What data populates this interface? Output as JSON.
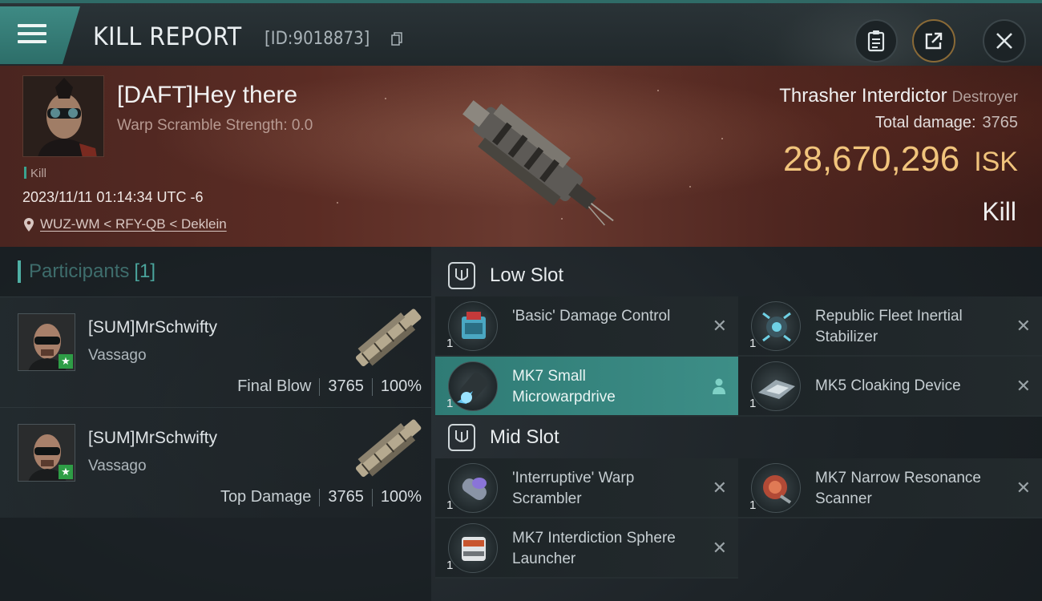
{
  "header": {
    "title": "KILL REPORT",
    "report_id": "[ID:9018873]"
  },
  "victim": {
    "name": "[DAFT]Hey there",
    "warp_scramble": "Warp Scramble Strength: 0.0",
    "tag": "Kill",
    "time": "2023/11/11 01:14:34 UTC -6",
    "location": "WUZ-WM < RFY-QB < Deklein",
    "ship": "Thrasher Interdictor",
    "ship_class": "Destroyer",
    "total_damage_label": "Total damage:",
    "total_damage": "3765",
    "isk_value": "28,670,296",
    "isk_unit": "ISK",
    "result": "Kill"
  },
  "participants": {
    "label": "Participants",
    "count": "[1]",
    "rows": [
      {
        "name": "[SUM]MrSchwifty",
        "ship": "Vassago",
        "role": "Final Blow",
        "damage": "3765",
        "percent": "100%"
      },
      {
        "name": "[SUM]MrSchwifty",
        "ship": "Vassago",
        "role": "Top Damage",
        "damage": "3765",
        "percent": "100%"
      }
    ]
  },
  "low_slot": {
    "label": "Low Slot",
    "items": [
      {
        "name": "'Basic' Damage Control",
        "qty": "1"
      },
      {
        "name": "Republic Fleet Inertial Stabilizer",
        "qty": "1"
      },
      {
        "name": "MK7 Small Microwarpdrive",
        "qty": "1"
      },
      {
        "name": "MK5 Cloaking Device",
        "qty": "1"
      }
    ]
  },
  "mid_slot": {
    "label": "Mid Slot",
    "items": [
      {
        "name": "'Interruptive' Warp Scrambler",
        "qty": "1"
      },
      {
        "name": "MK7 Narrow Resonance Scanner",
        "qty": "1"
      },
      {
        "name": "MK7 Interdiction Sphere Launcher",
        "qty": "1"
      }
    ]
  },
  "icons": {
    "menu": "hamburger-icon",
    "copy": "copy-icon",
    "clipboard": "clipboard-icon",
    "share": "share-icon",
    "close": "close-icon",
    "location": "location-pin-icon",
    "slot": "module-slot-icon",
    "remove": "close-x-icon",
    "pilot": "person-icon"
  },
  "colors": {
    "accent": "#3e8a84",
    "isk": "#f1c47c",
    "highlight_row": "#3d8e87"
  }
}
